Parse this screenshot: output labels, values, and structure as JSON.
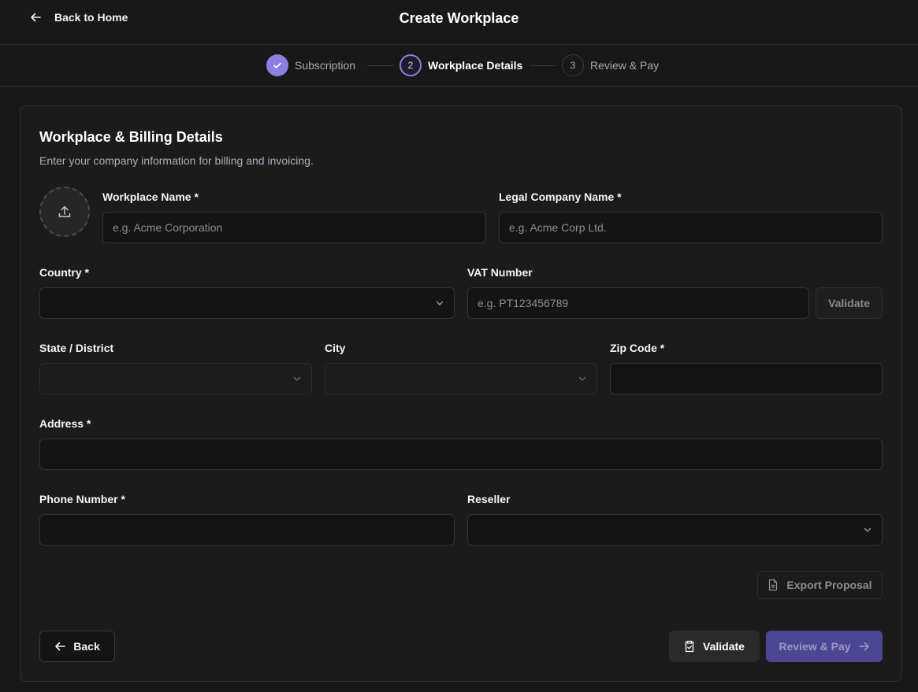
{
  "header": {
    "back_label": "Back to Home",
    "title": "Create Workplace"
  },
  "stepper": {
    "steps": [
      {
        "label": "Subscription",
        "status": "completed",
        "marker": "check-icon"
      },
      {
        "label": "Workplace Details",
        "status": "active",
        "number": "2"
      },
      {
        "label": "Review & Pay",
        "status": "upcoming",
        "number": "3"
      }
    ]
  },
  "card": {
    "title": "Workplace & Billing Details",
    "subtitle": "Enter your company information for billing and invoicing."
  },
  "form": {
    "workplace_name": {
      "label": "Workplace Name *",
      "placeholder": "e.g. Acme Corporation",
      "value": ""
    },
    "legal_name": {
      "label": "Legal Company Name *",
      "placeholder": "e.g. Acme Corp Ltd.",
      "value": ""
    },
    "country": {
      "label": "Country *",
      "value": ""
    },
    "vat": {
      "label": "VAT Number",
      "placeholder": "e.g. PT123456789",
      "value": "",
      "validate_label": "Validate"
    },
    "state": {
      "label": "State / District",
      "value": "",
      "disabled": true
    },
    "city": {
      "label": "City",
      "value": "",
      "disabled": true
    },
    "zip": {
      "label": "Zip Code *",
      "value": ""
    },
    "address": {
      "label": "Address *",
      "value": ""
    },
    "phone": {
      "label": "Phone Number *",
      "value": ""
    },
    "reseller": {
      "label": "Reseller",
      "value": ""
    }
  },
  "actions": {
    "export_label": "Export Proposal",
    "back_label": "Back",
    "validate_label": "Validate",
    "review_label": "Review & Pay"
  },
  "colors": {
    "accent": "#8b7fe0",
    "primary_button": "#4c4694",
    "background": "#181818",
    "card": "#1b1b1b"
  }
}
